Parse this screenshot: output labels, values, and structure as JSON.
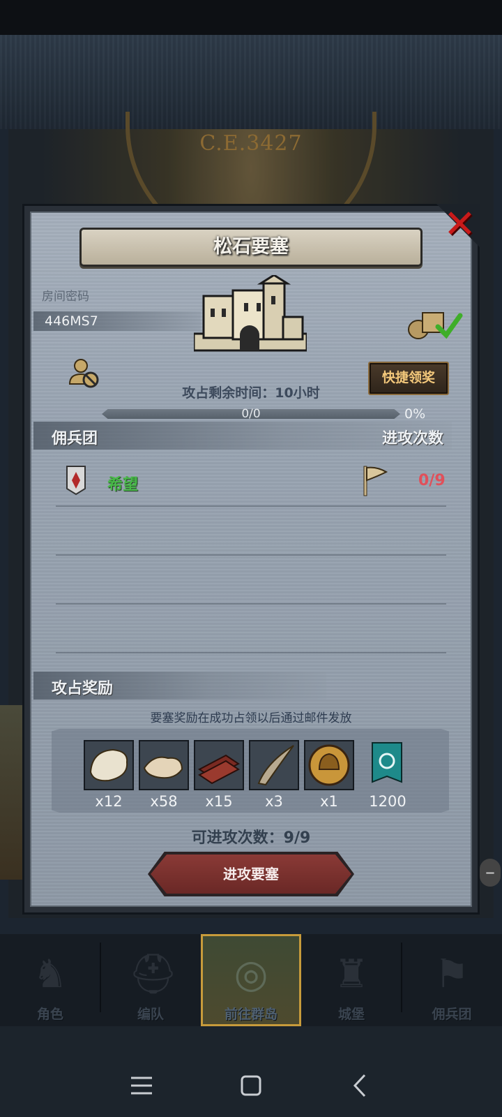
{
  "background": {
    "era": "C.E.3427"
  },
  "panel": {
    "title": "松石要塞",
    "room_label": "房间密码",
    "room_code": "446MS7",
    "quick_claim_label": "快捷领奖",
    "time_label": "攻占剩余时间：",
    "time_value": "10小时",
    "progress_count": "0/0",
    "progress_percent": "0%",
    "progress_fraction": 0
  },
  "mercenary_section": {
    "title": "佣兵团",
    "right_header": "进攻次数",
    "rows": [
      {
        "name": "希望",
        "attacks": "0/9"
      }
    ]
  },
  "rewards_section": {
    "title": "攻占奖励",
    "note": "要塞奖励在成功占领以后通过邮件发放",
    "items": [
      {
        "icon": "fur-icon",
        "qty": "x12"
      },
      {
        "icon": "hide-icon",
        "qty": "x58"
      },
      {
        "icon": "wood-planks-icon",
        "qty": "x15"
      },
      {
        "icon": "horn-icon",
        "qty": "x3"
      },
      {
        "icon": "gold-helmet-coin-icon",
        "qty": "x1"
      },
      {
        "icon": "banner-emblem-icon",
        "qty": "1200"
      }
    ]
  },
  "attack": {
    "count_label": "可进攻次数：",
    "count_value": "9/9",
    "button_label": "进攻要塞"
  },
  "bottom_nav": [
    {
      "label": "角色",
      "icon": "knight-icon",
      "active": false
    },
    {
      "label": "编队",
      "icon": "helmet-icon",
      "active": false
    },
    {
      "label": "前往群岛",
      "icon": "compass-map-icon",
      "active": true
    },
    {
      "label": "城堡",
      "icon": "castle-icon",
      "active": false
    },
    {
      "label": "佣兵团",
      "icon": "mercenary-icon",
      "active": false
    }
  ],
  "colors": {
    "merc_name": "#48b848",
    "attacks_value": "#e0505a",
    "close": "#c81a1a",
    "quick_btn_text": "#f3c87b",
    "attack_btn": "#7a302e"
  }
}
